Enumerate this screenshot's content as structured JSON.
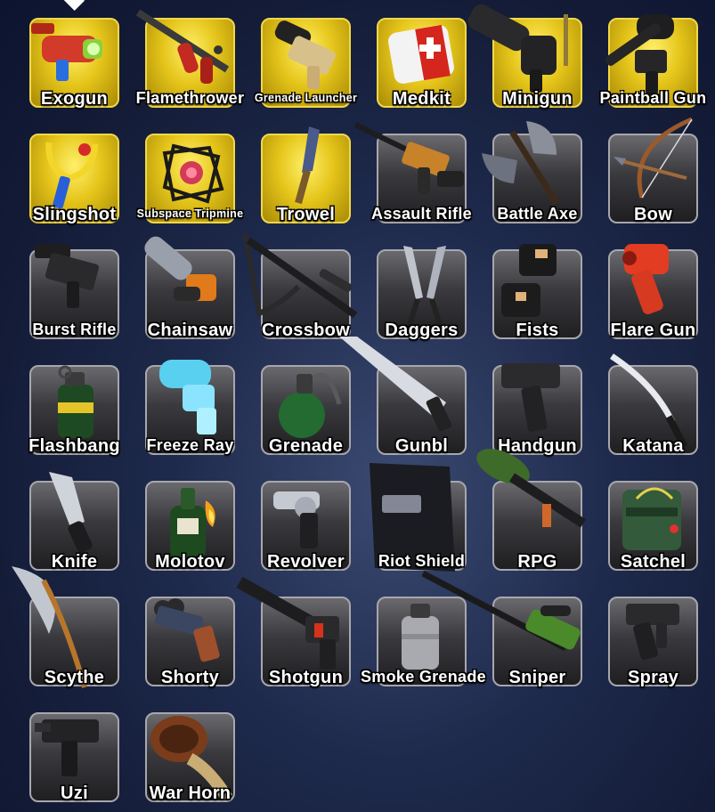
{
  "items": [
    {
      "name": "Exogun",
      "icon": "exogun-icon",
      "rarity": "gold"
    },
    {
      "name": "Flamethrower",
      "icon": "flamethrower-icon",
      "rarity": "gold"
    },
    {
      "name": "Grenade Launcher",
      "icon": "grenade-launcher-icon",
      "rarity": "gold"
    },
    {
      "name": "Medkit",
      "icon": "medkit-icon",
      "rarity": "gold"
    },
    {
      "name": "Minigun",
      "icon": "minigun-icon",
      "rarity": "gold"
    },
    {
      "name": "Paintball Gun",
      "icon": "paintball-gun-icon",
      "rarity": "gold"
    },
    {
      "name": "Slingshot",
      "icon": "slingshot-icon",
      "rarity": "gold"
    },
    {
      "name": "Subspace Tripmine",
      "icon": "subspace-tripmine-icon",
      "rarity": "gold"
    },
    {
      "name": "Trowel",
      "icon": "trowel-icon",
      "rarity": "gold"
    },
    {
      "name": "Assault Rifle",
      "icon": "assault-rifle-icon",
      "rarity": "standard"
    },
    {
      "name": "Battle Axe",
      "icon": "battle-axe-icon",
      "rarity": "standard"
    },
    {
      "name": "Bow",
      "icon": "bow-icon",
      "rarity": "standard"
    },
    {
      "name": "Burst Rifle",
      "icon": "burst-rifle-icon",
      "rarity": "standard"
    },
    {
      "name": "Chainsaw",
      "icon": "chainsaw-icon",
      "rarity": "standard"
    },
    {
      "name": "Crossbow",
      "icon": "crossbow-icon",
      "rarity": "standard"
    },
    {
      "name": "Daggers",
      "icon": "daggers-icon",
      "rarity": "standard"
    },
    {
      "name": "Fists",
      "icon": "fists-icon",
      "rarity": "standard"
    },
    {
      "name": "Flare Gun",
      "icon": "flare-gun-icon",
      "rarity": "standard"
    },
    {
      "name": "Flashbang",
      "icon": "flashbang-icon",
      "rarity": "standard"
    },
    {
      "name": "Freeze Ray",
      "icon": "freeze-ray-icon",
      "rarity": "standard"
    },
    {
      "name": "Grenade",
      "icon": "grenade-icon",
      "rarity": "standard"
    },
    {
      "name": "Gunbl",
      "icon": "gunblade-icon",
      "rarity": "standard"
    },
    {
      "name": "Handgun",
      "icon": "handgun-icon",
      "rarity": "standard"
    },
    {
      "name": "Katana",
      "icon": "katana-icon",
      "rarity": "standard"
    },
    {
      "name": "Knife",
      "icon": "knife-icon",
      "rarity": "standard"
    },
    {
      "name": "Molotov",
      "icon": "molotov-icon",
      "rarity": "standard"
    },
    {
      "name": "Revolver",
      "icon": "revolver-icon",
      "rarity": "standard"
    },
    {
      "name": "Riot Shield",
      "icon": "riot-shield-icon",
      "rarity": "standard"
    },
    {
      "name": "RPG",
      "icon": "rpg-icon",
      "rarity": "standard"
    },
    {
      "name": "Satchel",
      "icon": "satchel-icon",
      "rarity": "standard"
    },
    {
      "name": "Scythe",
      "icon": "scythe-icon",
      "rarity": "standard"
    },
    {
      "name": "Shorty",
      "icon": "shorty-icon",
      "rarity": "standard"
    },
    {
      "name": "Shotgun",
      "icon": "shotgun-icon",
      "rarity": "standard"
    },
    {
      "name": "Smoke Grenade",
      "icon": "smoke-grenade-icon",
      "rarity": "standard"
    },
    {
      "name": "Sniper",
      "icon": "sniper-icon",
      "rarity": "standard"
    },
    {
      "name": "Spray",
      "icon": "spray-icon",
      "rarity": "standard"
    },
    {
      "name": "Uzi",
      "icon": "uzi-icon",
      "rarity": "standard"
    },
    {
      "name": "War Horn",
      "icon": "war-horn-icon",
      "rarity": "standard"
    }
  ]
}
